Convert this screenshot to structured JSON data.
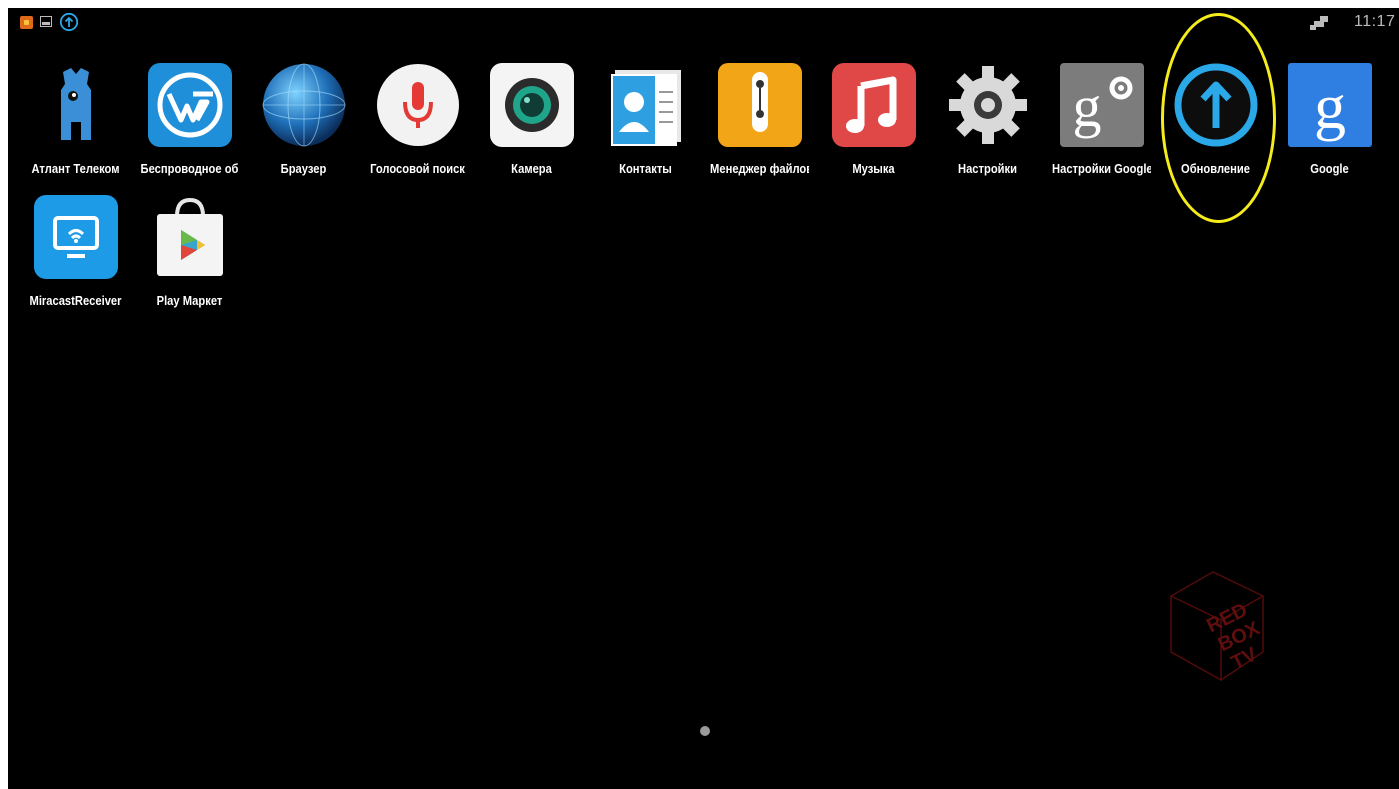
{
  "status_bar": {
    "time": "11:17",
    "icons": [
      "app-notification-icon",
      "gallery-icon",
      "upload-icon",
      "network-icon"
    ]
  },
  "apps": [
    {
      "label": "Атлант Телеком",
      "icon": "atlant-telecom-icon"
    },
    {
      "label": "Беспроводное об",
      "icon": "wireless-icon"
    },
    {
      "label": "Браузер",
      "icon": "browser-globe-icon"
    },
    {
      "label": "Голосовой поиск",
      "icon": "microphone-icon"
    },
    {
      "label": "Камера",
      "icon": "camera-icon"
    },
    {
      "label": "Контакты",
      "icon": "contacts-icon"
    },
    {
      "label": "Менеджер файлов",
      "icon": "file-manager-icon"
    },
    {
      "label": "Музыка",
      "icon": "music-note-icon"
    },
    {
      "label": "Настройки",
      "icon": "gear-icon"
    },
    {
      "label": "Настройки Google",
      "icon": "google-settings-icon"
    },
    {
      "label": "Обновление",
      "icon": "update-arrow-icon"
    },
    {
      "label": "Google",
      "icon": "google-icon"
    },
    {
      "label": "MiracastReceiver",
      "icon": "miracast-icon"
    },
    {
      "label": "Play Маркет",
      "icon": "play-store-icon"
    }
  ],
  "watermark": {
    "lines": [
      "RED",
      "BOX",
      "TV"
    ]
  },
  "colors": {
    "highlight": "#f5ec1b",
    "update_blue": "#2aa8e8",
    "background": "#000000"
  }
}
